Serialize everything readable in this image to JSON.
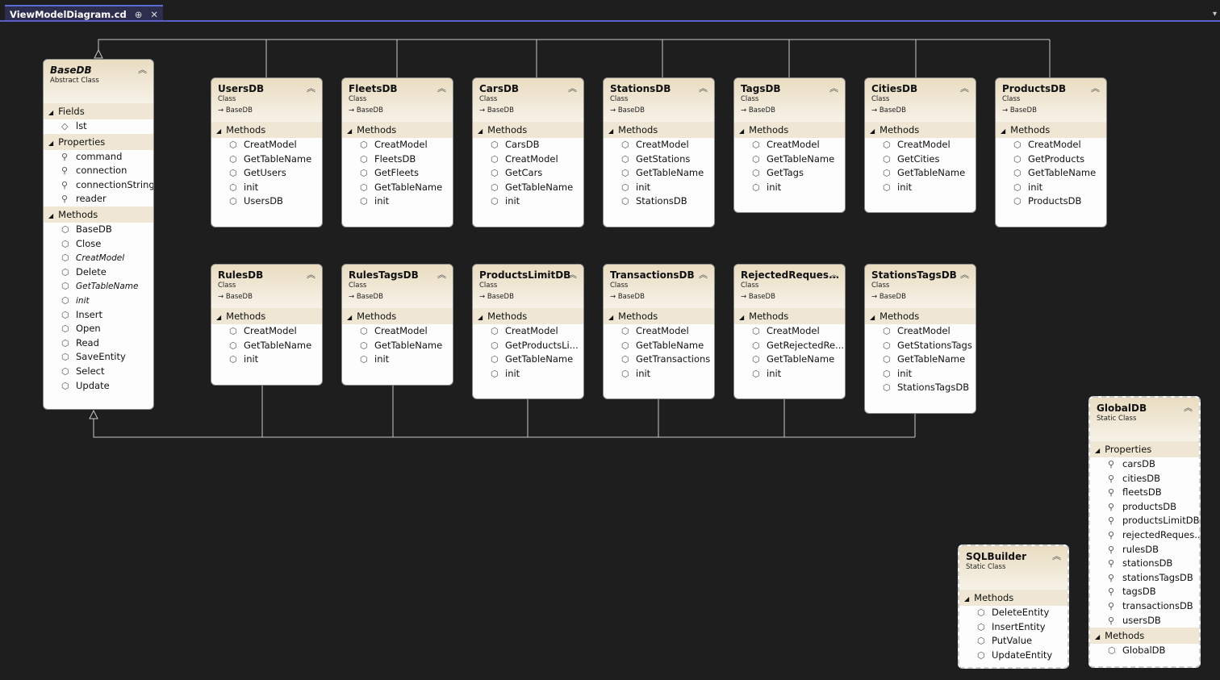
{
  "tab": {
    "title": "ViewModelDiagram.cd",
    "pin": "⊕",
    "close": "✕"
  },
  "boxes": {
    "basedb": {
      "name": "BaseDB",
      "kind": "Abstract Class",
      "fields_label": "Fields",
      "fields": [
        "lst"
      ],
      "properties_label": "Properties",
      "properties": [
        "command",
        "connection",
        "connectionString",
        "reader"
      ],
      "methods_label": "Methods",
      "methods": [
        "BaseDB",
        "Close",
        "CreatModel",
        "Delete",
        "GetTableName",
        "init",
        "Insert",
        "Open",
        "Read",
        "SaveEntity",
        "Select",
        "Update"
      ]
    },
    "usersdb": {
      "name": "UsersDB",
      "kind": "Class",
      "inherits": "BaseDB",
      "methods_label": "Methods",
      "methods": [
        "CreatModel",
        "GetTableName",
        "GetUsers",
        "init",
        "UsersDB"
      ]
    },
    "fleetsdb": {
      "name": "FleetsDB",
      "kind": "Class",
      "inherits": "BaseDB",
      "methods_label": "Methods",
      "methods": [
        "CreatModel",
        "FleetsDB",
        "GetFleets",
        "GetTableName",
        "init"
      ]
    },
    "carsdb": {
      "name": "CarsDB",
      "kind": "Class",
      "inherits": "BaseDB",
      "methods_label": "Methods",
      "methods": [
        "CarsDB",
        "CreatModel",
        "GetCars",
        "GetTableName",
        "init"
      ]
    },
    "stationsdb": {
      "name": "StationsDB",
      "kind": "Class",
      "inherits": "BaseDB",
      "methods_label": "Methods",
      "methods": [
        "CreatModel",
        "GetStations",
        "GetTableName",
        "init",
        "StationsDB"
      ]
    },
    "tagsdb": {
      "name": "TagsDB",
      "kind": "Class",
      "inherits": "BaseDB",
      "methods_label": "Methods",
      "methods": [
        "CreatModel",
        "GetTableName",
        "GetTags",
        "init"
      ]
    },
    "citiesdb": {
      "name": "CitiesDB",
      "kind": "Class",
      "inherits": "BaseDB",
      "methods_label": "Methods",
      "methods": [
        "CreatModel",
        "GetCities",
        "GetTableName",
        "init"
      ]
    },
    "productsdb": {
      "name": "ProductsDB",
      "kind": "Class",
      "inherits": "BaseDB",
      "methods_label": "Methods",
      "methods": [
        "CreatModel",
        "GetProducts",
        "GetTableName",
        "init",
        "ProductsDB"
      ]
    },
    "rulesdb": {
      "name": "RulesDB",
      "kind": "Class",
      "inherits": "BaseDB",
      "methods_label": "Methods",
      "methods": [
        "CreatModel",
        "GetTableName",
        "init"
      ]
    },
    "rulestagsdb": {
      "name": "RulesTagsDB",
      "kind": "Class",
      "inherits": "BaseDB",
      "methods_label": "Methods",
      "methods": [
        "CreatModel",
        "GetTableName",
        "init"
      ]
    },
    "productslimitdb": {
      "name": "ProductsLimitDB",
      "kind": "Class",
      "inherits": "BaseDB",
      "methods_label": "Methods",
      "methods": [
        "CreatModel",
        "GetProductsLi...",
        "GetTableName",
        "init"
      ]
    },
    "transactionsdb": {
      "name": "TransactionsDB",
      "kind": "Class",
      "inherits": "BaseDB",
      "methods_label": "Methods",
      "methods": [
        "CreatModel",
        "GetTableName",
        "GetTransactions",
        "init"
      ]
    },
    "rejectedrequests": {
      "name": "RejectedReques...",
      "kind": "Class",
      "inherits": "BaseDB",
      "methods_label": "Methods",
      "methods": [
        "CreatModel",
        "GetRejectedRe...",
        "GetTableName",
        "init"
      ]
    },
    "stationstagsdb": {
      "name": "StationsTagsDB",
      "kind": "Class",
      "inherits": "BaseDB",
      "methods_label": "Methods",
      "methods": [
        "CreatModel",
        "GetStationsTags",
        "GetTableName",
        "init",
        "StationsTagsDB"
      ]
    },
    "sqlbuilder": {
      "name": "SQLBuilder",
      "kind": "Static Class",
      "methods_label": "Methods",
      "methods": [
        "DeleteEntity",
        "InsertEntity",
        "PutValue",
        "UpdateEntity"
      ]
    },
    "globaldb": {
      "name": "GlobalDB",
      "kind": "Static Class",
      "properties_label": "Properties",
      "properties": [
        "carsDB",
        "citiesDB",
        "fleetsDB",
        "productsDB",
        "productsLimitDB",
        "rejectedReques...",
        "rulesDB",
        "stationsDB",
        "stationsTagsDB",
        "tagsDB",
        "transactionsDB",
        "usersDB"
      ],
      "methods_label": "Methods",
      "methods": [
        "GlobalDB"
      ]
    }
  },
  "colors": {
    "background": "#1e1e1e",
    "header": "#e9dcc1",
    "section": "#efe6d3",
    "tab_accent": "#5b5fc7"
  }
}
